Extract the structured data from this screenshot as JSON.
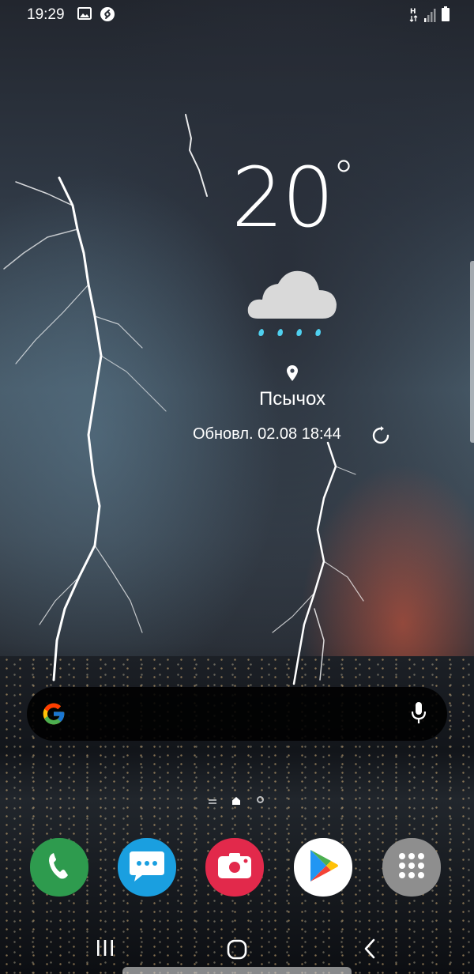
{
  "status_bar": {
    "time": "19:29",
    "icons": [
      "gallery-icon",
      "shazam-icon",
      "network-h-icon",
      "signal-icon",
      "battery-icon"
    ],
    "network_type": "H"
  },
  "weather": {
    "temperature": "20",
    "degree_symbol": "°",
    "condition_icon": "rain-cloud-icon",
    "location": "Псычох",
    "updated": "Обновл. 02.08 18:44",
    "refresh_icon": "refresh-icon"
  },
  "search": {
    "logo_icon": "google-g-icon",
    "voice_icon": "microphone-icon"
  },
  "page_indicator": {
    "pages": [
      "list",
      "home",
      "page"
    ],
    "current": "home"
  },
  "dock": {
    "apps": [
      {
        "name": "Phone",
        "icon": "phone-icon",
        "color": "#2e9b4e"
      },
      {
        "name": "Messages",
        "icon": "messages-icon",
        "color": "#1a9fe0"
      },
      {
        "name": "Screen Recorder",
        "icon": "camera-record-icon",
        "color": "#e2294b"
      },
      {
        "name": "Play Store",
        "icon": "play-store-icon",
        "color": "#ffffff"
      },
      {
        "name": "Apps",
        "icon": "apps-grid-icon",
        "color": "#8e8e8e"
      }
    ]
  },
  "navigation": {
    "buttons": [
      "recents-icon",
      "home-icon",
      "back-icon"
    ]
  }
}
